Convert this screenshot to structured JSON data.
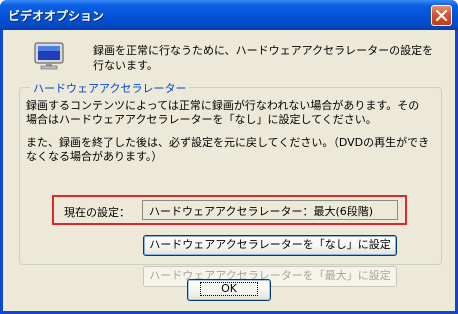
{
  "window": {
    "title": "ビデオオプション",
    "close_label": "×"
  },
  "intro_text": "録画を正常に行なうために、ハードウェアアクセラレーターの設定を\n行ないます。",
  "group": {
    "legend": "ハードウェアアクセラレーター",
    "paragraph1": "録画するコンテンツによっては正常に録画が行なわれない場合があります。その\n場合はハードウェアアクセラレーターを「なし」に設定してください。",
    "paragraph2": "また、録画を終了した後は、必ず設定を元に戻してください。（DVDの再生ができ\nなくなる場合があります。）",
    "current_label": "現在の設定：",
    "current_value": "ハードウェアアクセラレーター：最大(6段階)",
    "set_none_button": "ハードウェアアクセラレーターを「なし」に設定",
    "set_max_button": "ハードウェアアクセラレーターを「最大」に設定"
  },
  "ok_button": "OK",
  "colors": {
    "titlebar": "#0552d6",
    "client_background": "#ece9d8",
    "group_legend": "#0046d5",
    "highlight_border": "#e0262a"
  },
  "icons": {
    "title_close": "close-icon",
    "dialog_icon": "monitor-icon"
  }
}
